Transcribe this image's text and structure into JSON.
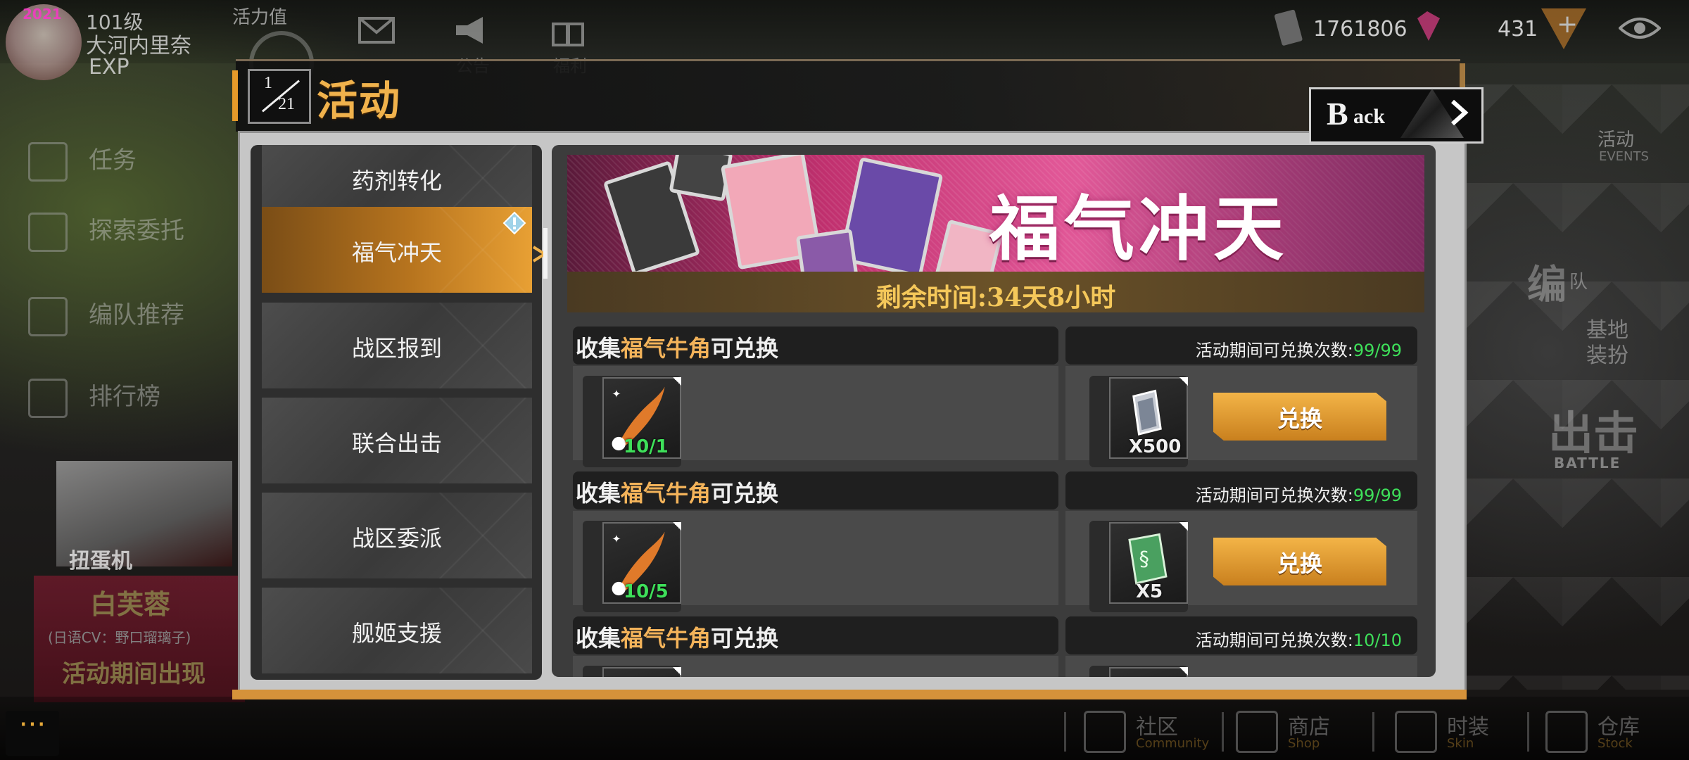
{
  "player": {
    "year": "2021",
    "level": "101级",
    "name": "大河内里奈",
    "exp_label": "EXP"
  },
  "topbar": {
    "vitality_label": "活力值",
    "mail_label": "公告",
    "notice_label": "福利",
    "coins": "1761806",
    "gems": "431",
    "plus": "+"
  },
  "left_menu": [
    {
      "label": "任务",
      "icon": "clipboard-icon"
    },
    {
      "label": "探索委托",
      "icon": "scroll-icon"
    },
    {
      "label": "编队推荐",
      "icon": "fleet-icon"
    },
    {
      "label": "排行榜",
      "icon": "ranking-icon"
    }
  ],
  "gacha_label": "扭蛋机",
  "promo": {
    "name": "白芙蓉",
    "cv": "(日语CV：野口瑠璃子)",
    "tagline": "活动期间出现"
  },
  "right_side": {
    "events_cn": "活动",
    "events_en": "EVENTS",
    "fleet_cn": "编",
    "fleet_cn2": "队",
    "base_line1": "基地",
    "base_line2": "装扮",
    "battle_cn": "出击",
    "battle_en": "BATTLE"
  },
  "bottom_nav": [
    {
      "cn": "社区",
      "en": "Community",
      "icon": "community-icon"
    },
    {
      "cn": "商店",
      "en": "Shop",
      "icon": "shop-icon"
    },
    {
      "cn": "时装",
      "en": "Skin",
      "icon": "skin-icon"
    },
    {
      "cn": "仓库",
      "en": "Stock",
      "icon": "stock-icon"
    }
  ],
  "more_label": "···",
  "dialog": {
    "page_num": "1",
    "page_den": "21",
    "title": "活动",
    "back_big": "B",
    "back_small": "ack",
    "tabs": [
      {
        "label": "药剂转化",
        "active": false
      },
      {
        "label": "福气冲天",
        "active": true
      },
      {
        "label": "战区报到",
        "active": false
      },
      {
        "label": "联合出击",
        "active": false
      },
      {
        "label": "战区委派",
        "active": false
      },
      {
        "label": "舰姬支援",
        "active": false
      }
    ],
    "banner_title": "福气冲天",
    "timer": "剩余时间:34天8小时",
    "exchange_rows": [
      {
        "head_pre": "收集",
        "head_hl": "福气牛角",
        "head_post": "可兑换",
        "limit_label": "活动期间可兑换次数:",
        "limit_value": "99/99",
        "cost_qty": "10/1",
        "reward_qty": "X500",
        "reward_icon": "silver-ticket-icon",
        "button": "兑换"
      },
      {
        "head_pre": "收集",
        "head_hl": "福气牛角",
        "head_post": "可兑换",
        "limit_label": "活动期间可兑换次数:",
        "limit_value": "99/99",
        "cost_qty": "10/5",
        "reward_qty": "X5",
        "reward_icon": "green-chip-icon",
        "button": "兑换"
      },
      {
        "head_pre": "收集",
        "head_hl": "福气牛角",
        "head_post": "可兑换",
        "limit_label": "活动期间可兑换次数:",
        "limit_value": "10/10",
        "cost_qty": "",
        "reward_qty": "",
        "reward_icon": "",
        "button": ""
      }
    ]
  },
  "colors": {
    "accent_orange": "#e8a034",
    "title_gold": "#f0b24c",
    "highlight_gold": "#f3b35a",
    "count_green": "#3ee05a"
  }
}
